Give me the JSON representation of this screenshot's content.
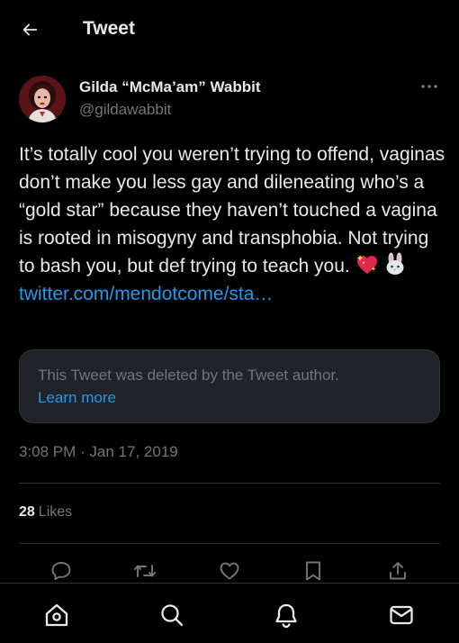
{
  "header": {
    "title": "Tweet",
    "back_icon": "arrow-left-icon"
  },
  "author": {
    "name": "Gilda “McMa’am” Wabbit",
    "handle": "@gildawabbit"
  },
  "tweet": {
    "text": "It’s totally cool you weren’t trying to offend, vaginas don’t make you less gay and dileneating who’s a “gold star” because they haven’t touched a vagina is rooted in misogyny and transphobia. Not trying to bash you, but def trying to teach you.",
    "emojis": [
      "sparkling-heart-icon",
      "rabbit-face-icon"
    ],
    "link": "twitter.com/mendotcome/sta…"
  },
  "quote": {
    "deleted_text": "This Tweet was deleted by the Tweet author.",
    "learn_more": "Learn more"
  },
  "timestamp": "3:08 PM · Jan 17, 2019",
  "stats": {
    "likes_count": "28",
    "likes_label": "Likes"
  },
  "actions": [
    "reply-icon",
    "retweet-icon",
    "like-icon",
    "bookmark-icon",
    "share-icon"
  ],
  "bottom_nav": [
    "home-icon",
    "search-icon",
    "notifications-icon",
    "messages-icon"
  ],
  "colors": {
    "background": "#000000",
    "text": "#e7e9ea",
    "secondary": "#71767b",
    "link": "#1d9bf0",
    "border": "#2f3336",
    "quote_bg": "#202327"
  }
}
